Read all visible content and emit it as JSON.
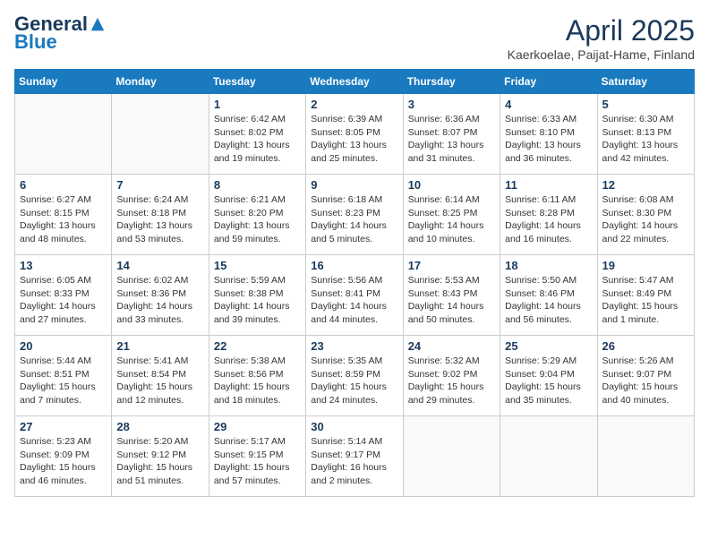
{
  "header": {
    "logo_general": "General",
    "logo_blue": "Blue",
    "month_title": "April 2025",
    "subtitle": "Kaerkoelae, Paijat-Hame, Finland"
  },
  "days_of_week": [
    "Sunday",
    "Monday",
    "Tuesday",
    "Wednesday",
    "Thursday",
    "Friday",
    "Saturday"
  ],
  "weeks": [
    [
      {
        "day": "",
        "info": ""
      },
      {
        "day": "",
        "info": ""
      },
      {
        "day": "1",
        "info": "Sunrise: 6:42 AM\nSunset: 8:02 PM\nDaylight: 13 hours and 19 minutes."
      },
      {
        "day": "2",
        "info": "Sunrise: 6:39 AM\nSunset: 8:05 PM\nDaylight: 13 hours and 25 minutes."
      },
      {
        "day": "3",
        "info": "Sunrise: 6:36 AM\nSunset: 8:07 PM\nDaylight: 13 hours and 31 minutes."
      },
      {
        "day": "4",
        "info": "Sunrise: 6:33 AM\nSunset: 8:10 PM\nDaylight: 13 hours and 36 minutes."
      },
      {
        "day": "5",
        "info": "Sunrise: 6:30 AM\nSunset: 8:13 PM\nDaylight: 13 hours and 42 minutes."
      }
    ],
    [
      {
        "day": "6",
        "info": "Sunrise: 6:27 AM\nSunset: 8:15 PM\nDaylight: 13 hours and 48 minutes."
      },
      {
        "day": "7",
        "info": "Sunrise: 6:24 AM\nSunset: 8:18 PM\nDaylight: 13 hours and 53 minutes."
      },
      {
        "day": "8",
        "info": "Sunrise: 6:21 AM\nSunset: 8:20 PM\nDaylight: 13 hours and 59 minutes."
      },
      {
        "day": "9",
        "info": "Sunrise: 6:18 AM\nSunset: 8:23 PM\nDaylight: 14 hours and 5 minutes."
      },
      {
        "day": "10",
        "info": "Sunrise: 6:14 AM\nSunset: 8:25 PM\nDaylight: 14 hours and 10 minutes."
      },
      {
        "day": "11",
        "info": "Sunrise: 6:11 AM\nSunset: 8:28 PM\nDaylight: 14 hours and 16 minutes."
      },
      {
        "day": "12",
        "info": "Sunrise: 6:08 AM\nSunset: 8:30 PM\nDaylight: 14 hours and 22 minutes."
      }
    ],
    [
      {
        "day": "13",
        "info": "Sunrise: 6:05 AM\nSunset: 8:33 PM\nDaylight: 14 hours and 27 minutes."
      },
      {
        "day": "14",
        "info": "Sunrise: 6:02 AM\nSunset: 8:36 PM\nDaylight: 14 hours and 33 minutes."
      },
      {
        "day": "15",
        "info": "Sunrise: 5:59 AM\nSunset: 8:38 PM\nDaylight: 14 hours and 39 minutes."
      },
      {
        "day": "16",
        "info": "Sunrise: 5:56 AM\nSunset: 8:41 PM\nDaylight: 14 hours and 44 minutes."
      },
      {
        "day": "17",
        "info": "Sunrise: 5:53 AM\nSunset: 8:43 PM\nDaylight: 14 hours and 50 minutes."
      },
      {
        "day": "18",
        "info": "Sunrise: 5:50 AM\nSunset: 8:46 PM\nDaylight: 14 hours and 56 minutes."
      },
      {
        "day": "19",
        "info": "Sunrise: 5:47 AM\nSunset: 8:49 PM\nDaylight: 15 hours and 1 minute."
      }
    ],
    [
      {
        "day": "20",
        "info": "Sunrise: 5:44 AM\nSunset: 8:51 PM\nDaylight: 15 hours and 7 minutes."
      },
      {
        "day": "21",
        "info": "Sunrise: 5:41 AM\nSunset: 8:54 PM\nDaylight: 15 hours and 12 minutes."
      },
      {
        "day": "22",
        "info": "Sunrise: 5:38 AM\nSunset: 8:56 PM\nDaylight: 15 hours and 18 minutes."
      },
      {
        "day": "23",
        "info": "Sunrise: 5:35 AM\nSunset: 8:59 PM\nDaylight: 15 hours and 24 minutes."
      },
      {
        "day": "24",
        "info": "Sunrise: 5:32 AM\nSunset: 9:02 PM\nDaylight: 15 hours and 29 minutes."
      },
      {
        "day": "25",
        "info": "Sunrise: 5:29 AM\nSunset: 9:04 PM\nDaylight: 15 hours and 35 minutes."
      },
      {
        "day": "26",
        "info": "Sunrise: 5:26 AM\nSunset: 9:07 PM\nDaylight: 15 hours and 40 minutes."
      }
    ],
    [
      {
        "day": "27",
        "info": "Sunrise: 5:23 AM\nSunset: 9:09 PM\nDaylight: 15 hours and 46 minutes."
      },
      {
        "day": "28",
        "info": "Sunrise: 5:20 AM\nSunset: 9:12 PM\nDaylight: 15 hours and 51 minutes."
      },
      {
        "day": "29",
        "info": "Sunrise: 5:17 AM\nSunset: 9:15 PM\nDaylight: 15 hours and 57 minutes."
      },
      {
        "day": "30",
        "info": "Sunrise: 5:14 AM\nSunset: 9:17 PM\nDaylight: 16 hours and 2 minutes."
      },
      {
        "day": "",
        "info": ""
      },
      {
        "day": "",
        "info": ""
      },
      {
        "day": "",
        "info": ""
      }
    ]
  ]
}
